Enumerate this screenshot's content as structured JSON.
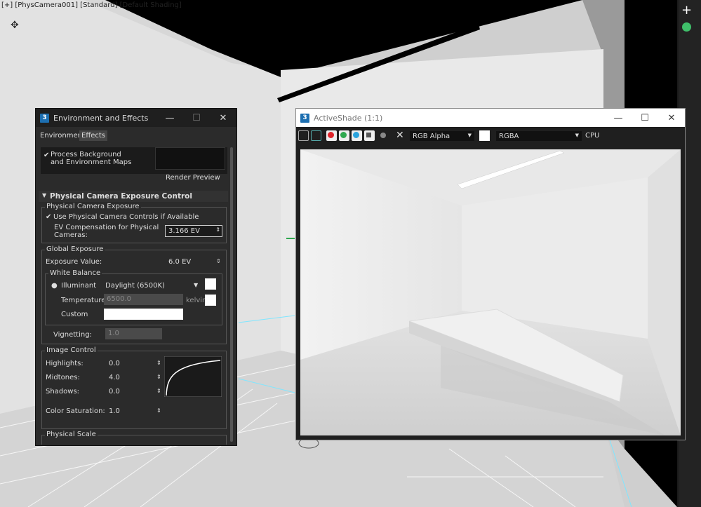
{
  "viewport": {
    "label": "[+] [PhysCamera001] [Standard] [Default Shading]"
  },
  "env_window": {
    "title": "Environment and Effects",
    "app_icon": "3",
    "tabs": [
      "Environment",
      "Effects"
    ],
    "active_tab": "Effects",
    "process_bg": "Process Background\nand Environment Maps",
    "process_bg_line1": "Process Background",
    "process_bg_line2": "and Environment Maps",
    "render_preview": "Render Preview",
    "rollout_title": "Physical Camera Exposure Control",
    "physical_camera_exposure": {
      "group": "Physical Camera Exposure",
      "use_controls": "Use Physical Camera Controls if Available",
      "ev_comp_label_1": "EV Compensation for Physical",
      "ev_comp_label_2": "Cameras:",
      "ev_comp_value": "3.166 EV"
    },
    "global_exposure": {
      "group": "Global Exposure",
      "exposure_label": "Exposure Value:",
      "exposure_value": "6.0 EV",
      "white_balance": "White Balance",
      "illuminant_label": "Illuminant",
      "illuminant_value": "Daylight (6500K)",
      "temperature_label": "Temperature",
      "temperature_value": "6500.0",
      "kelvin": "kelvin",
      "custom_label": "Custom",
      "vignetting_label": "Vignetting:",
      "vignetting_value": "1.0"
    },
    "image_control": {
      "group": "Image Control",
      "highlights_label": "Highlights:",
      "highlights_value": "0.0",
      "midtones_label": "Midtones:",
      "midtones_value": "4.0",
      "shadows_label": "Shadows:",
      "shadows_value": "0.0",
      "saturation_label": "Color Saturation:",
      "saturation_value": "1.0"
    },
    "physical_scale": "Physical Scale"
  },
  "activeshade": {
    "title": "ActiveShade (1:1)",
    "app_icon": "3",
    "channel_select": "RGB Alpha",
    "display_select": "RGBA",
    "device": "CPU"
  },
  "colors": {
    "channel_red": "#e0242a",
    "channel_green": "#2fa84f",
    "channel_blue": "#2aa3dd"
  }
}
